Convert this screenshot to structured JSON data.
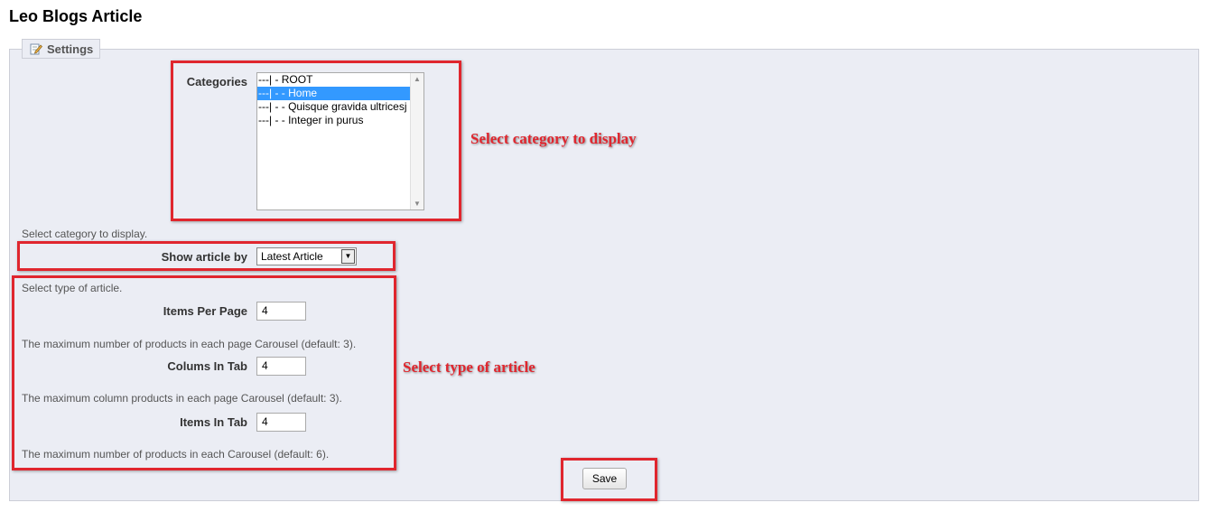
{
  "page_title": "Leo Blogs Article",
  "settings": {
    "legend": "Settings",
    "legend_icon": "edit-icon",
    "categories": {
      "label": "Categories",
      "options": [
        "---| - ROOT",
        "---| - - Home",
        "---| - - Quisque gravida ultricesj",
        "---| - - Integer in purus"
      ],
      "selected_index": 1,
      "help": "Select category to display."
    },
    "show_article_by": {
      "label": "Show article by",
      "value": "Latest Article",
      "help": "Select type of article."
    },
    "items_per_page": {
      "label": "Items Per Page",
      "value": "4",
      "help": "The maximum number of products in each page Carousel (default: 3)."
    },
    "colums_in_tab": {
      "label": "Colums In Tab",
      "value": "4",
      "help": "The maximum column products in each page Carousel (default: 3)."
    },
    "items_in_tab": {
      "label": "Items In Tab",
      "value": "4",
      "help": "The maximum number of products in each Carousel (default: 6)."
    },
    "save_label": "Save"
  },
  "annotations": {
    "category": "Select category to display",
    "type": "Select type of article",
    "color": "#e0262e"
  }
}
